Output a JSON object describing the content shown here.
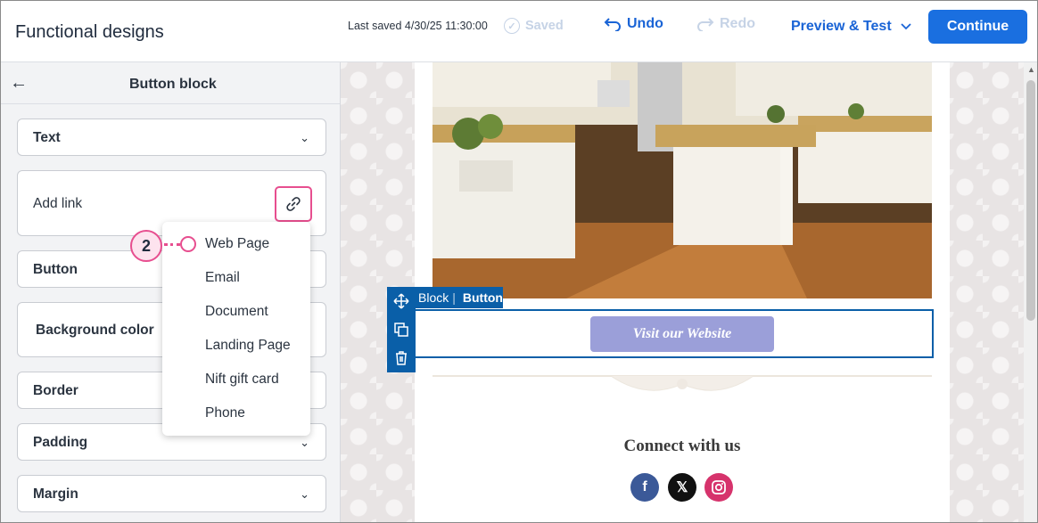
{
  "header": {
    "title": "Functional designs",
    "last_saved": "Last saved 4/30/25 11:30:00",
    "saved_label": "Saved",
    "undo_label": "Undo",
    "redo_label": "Redo",
    "preview_label": "Preview & Test",
    "continue_label": "Continue"
  },
  "panel": {
    "title": "Button block",
    "sections": {
      "text": "Text",
      "add_link": "Add link",
      "button": "Button",
      "background_color": "Background color",
      "border": "Border",
      "padding": "Padding",
      "margin": "Margin"
    }
  },
  "link_menu": {
    "items": [
      "Web Page",
      "Email",
      "Document",
      "Landing Page",
      "Nift gift card",
      "Phone"
    ],
    "callout_number": "2"
  },
  "canvas": {
    "block_tab_block": "Block",
    "block_tab_sep": "|",
    "block_tab_type": "Button",
    "button_text": "Visit our Website",
    "connect_heading": "Connect with us"
  },
  "icons": {
    "social": [
      "facebook-icon",
      "x-icon",
      "instagram-icon"
    ]
  },
  "colors": {
    "primary": "#1a6fe0",
    "accent_pink": "#e74e8f",
    "block_blue": "#0a5fa8",
    "button_purple": "#9b9fd9",
    "facebook": "#3b5998",
    "instagram": "#d6336c"
  }
}
